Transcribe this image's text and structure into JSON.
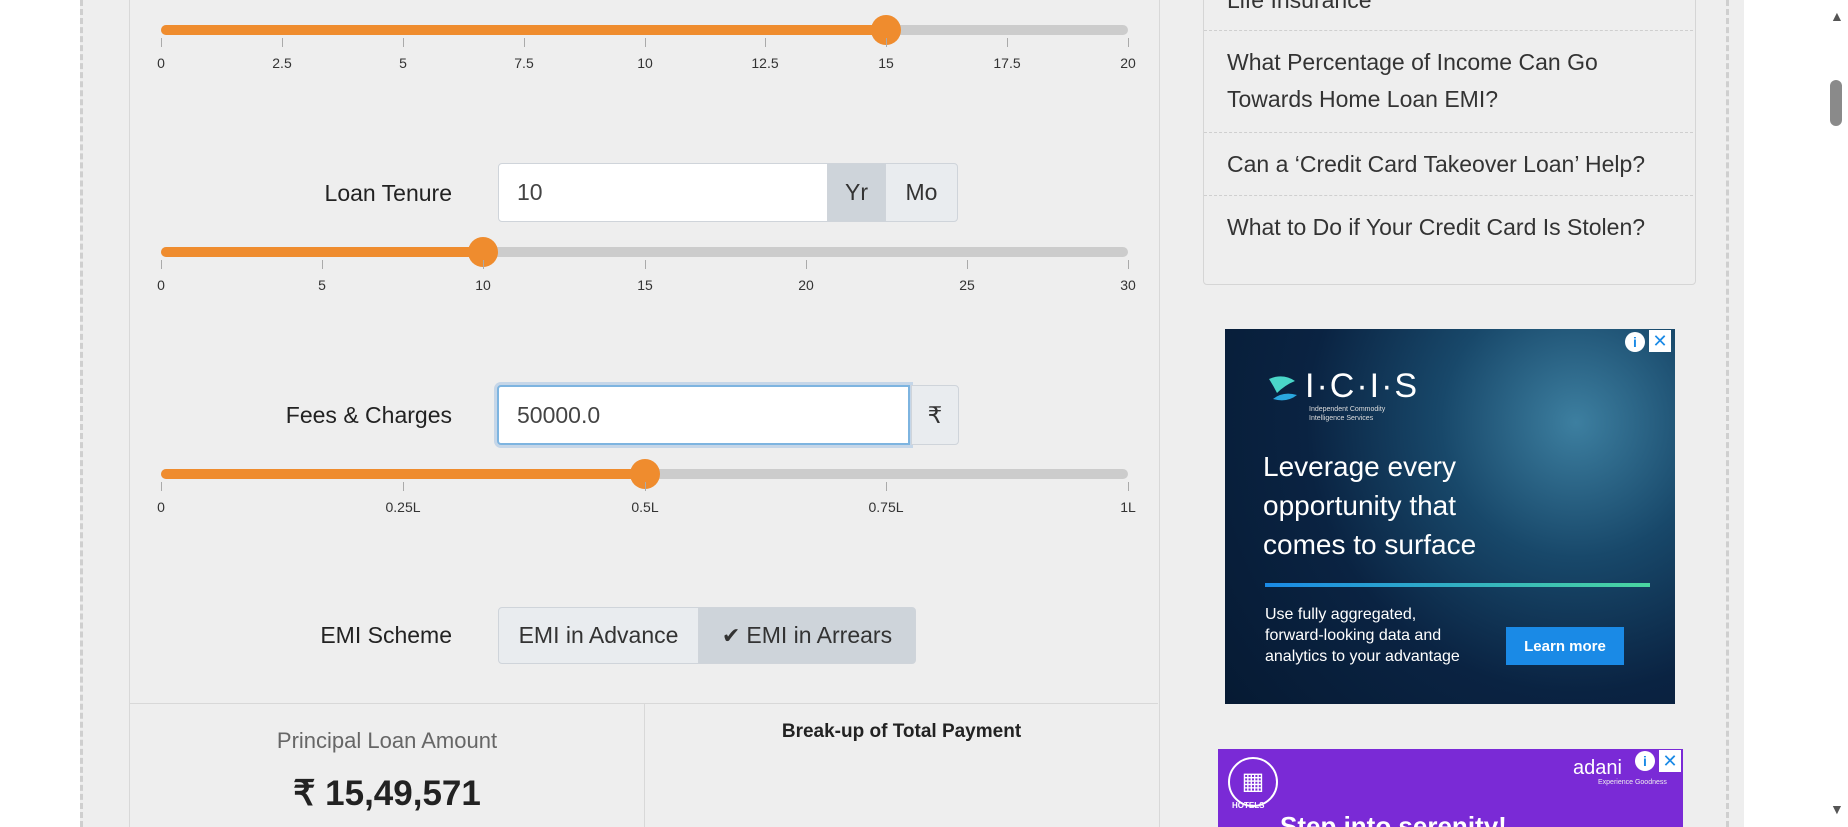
{
  "sliders": {
    "interest": {
      "ticks": [
        "0",
        "2.5",
        "5",
        "7.5",
        "10",
        "12.5",
        "15",
        "17.5",
        "20"
      ],
      "value": 15,
      "max": 20
    },
    "tenure": {
      "ticks": [
        "0",
        "5",
        "10",
        "15",
        "20",
        "25",
        "30"
      ],
      "value": 10,
      "max": 30
    },
    "fees": {
      "ticks": [
        "0",
        "0.25L",
        "0.5L",
        "0.75L",
        "1L"
      ],
      "value": 0.5,
      "max": 1
    }
  },
  "loan_tenure": {
    "label": "Loan Tenure",
    "value": "10",
    "unit_year": "Yr",
    "unit_month": "Mo",
    "active_unit": "Yr"
  },
  "fees_charges": {
    "label": "Fees & Charges",
    "value": "50000.0",
    "currency_symbol": "₹"
  },
  "emi_scheme": {
    "label": "EMI Scheme",
    "option_advance": "EMI in Advance",
    "option_arrears": "EMI in Arrears",
    "selected": "EMI in Arrears"
  },
  "summary": {
    "principal_label": "Principal Loan Amount",
    "principal_value": "₹ 15,49,571",
    "breakup_title": "Break-up of Total Payment"
  },
  "sidebar": {
    "links": [
      "Life Insurance",
      "What Percentage of Income Can Go Towards Home Loan EMI?",
      "Can a ‘Credit Card Takeover Loan’ Help?",
      "What to Do if Your Credit Card Is Stolen?"
    ]
  },
  "ad1": {
    "brand": "I·C·I·S",
    "brand_sub": "Independent Commodity Intelligence Services",
    "headline": "Leverage every opportunity that comes to surface",
    "body": "Use fully aggregated, forward-looking data and analytics to your advantage",
    "cta": "Learn more"
  },
  "ad2": {
    "brand": "adani",
    "brand_sub": "Experience Goodness",
    "hotels_label": "HOTELS",
    "headline": "Step into serenity!"
  },
  "colors": {
    "accent_orange": "#ef8c2e",
    "track_gray": "#cccccc",
    "cta_blue": "#1a8ae6"
  }
}
